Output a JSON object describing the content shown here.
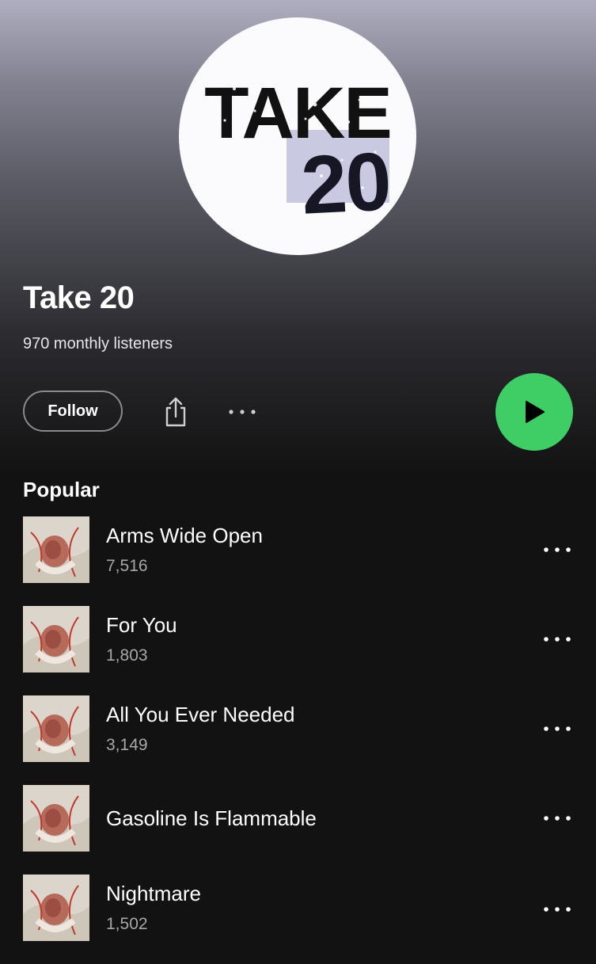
{
  "artist": {
    "name": "Take 20",
    "monthly_listeners": "970 monthly listeners",
    "avatar_text_top": "TAKE",
    "avatar_text_bottom": "20"
  },
  "actions": {
    "follow_label": "Follow",
    "share_icon": "share-icon",
    "more_icon": "more-horizontal-icon",
    "play_icon": "play-icon",
    "play_color": "#3fce66"
  },
  "popular": {
    "title": "Popular",
    "tracks": [
      {
        "title": "Arms Wide Open",
        "plays": "7,516"
      },
      {
        "title": "For You",
        "plays": "1,803"
      },
      {
        "title": "All You Ever Needed",
        "plays": "3,149"
      },
      {
        "title": "Gasoline Is Flammable",
        "plays": ""
      },
      {
        "title": "Nightmare",
        "plays": "1,502"
      }
    ]
  }
}
